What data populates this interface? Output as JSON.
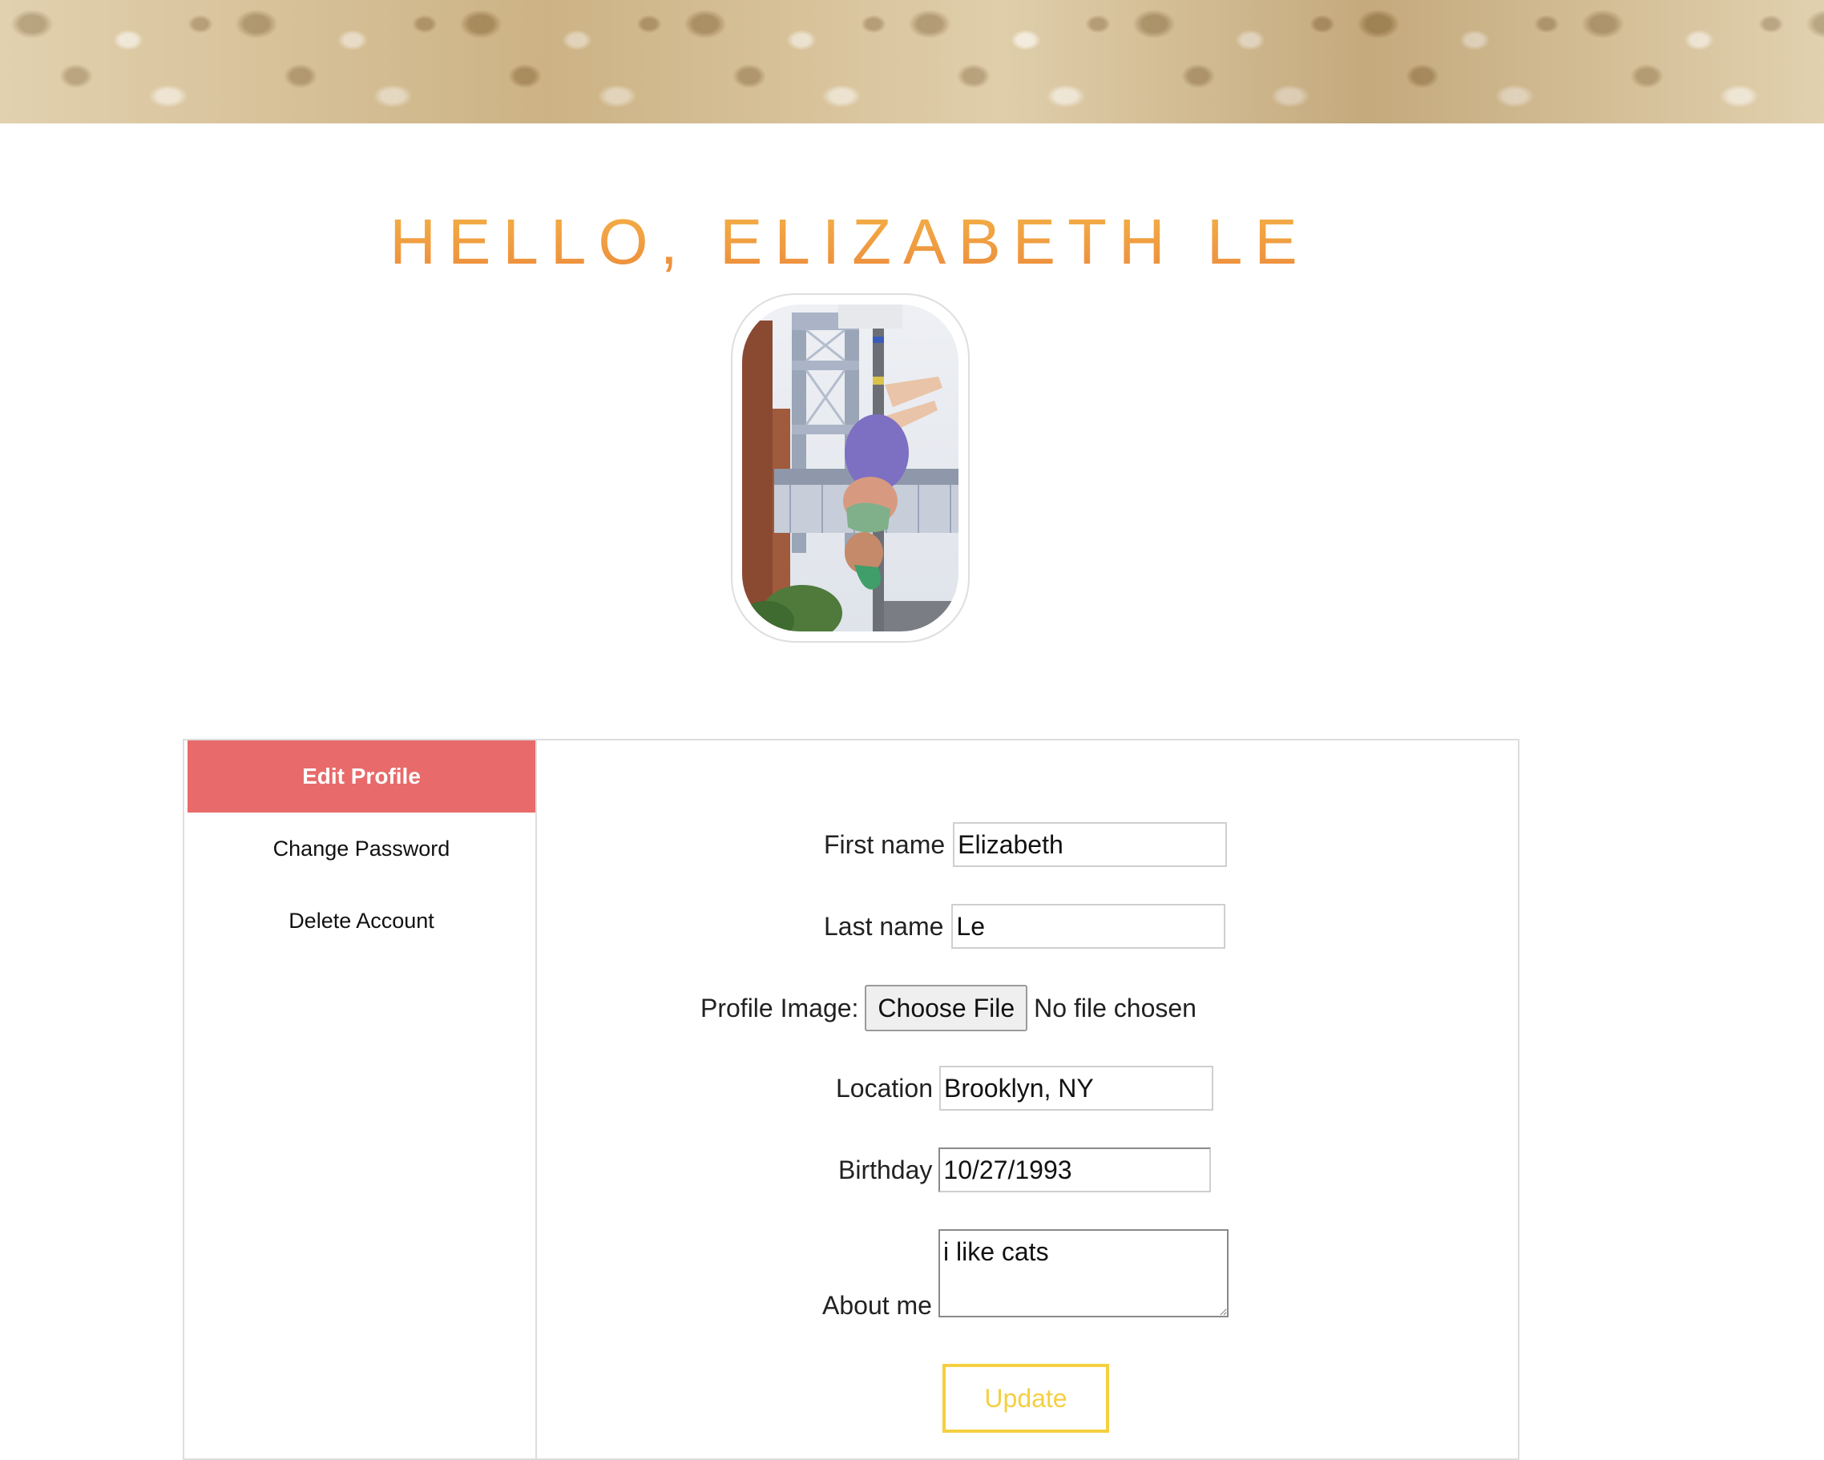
{
  "greeting": "HELLO, ELIZABETH LE",
  "sidebar": {
    "items": [
      {
        "label": "Edit Profile",
        "active": true
      },
      {
        "label": "Change Password",
        "active": false
      },
      {
        "label": "Delete Account",
        "active": false
      }
    ]
  },
  "form": {
    "first_name": {
      "label": "First name",
      "value": "Elizabeth"
    },
    "last_name": {
      "label": "Last name",
      "value": "Le"
    },
    "profile_image": {
      "label": "Profile Image:",
      "button": "Choose File",
      "status": "No file chosen"
    },
    "location": {
      "label": "Location",
      "value": "Brooklyn, NY"
    },
    "birthday": {
      "label": "Birthday",
      "value": "10/27/1993"
    },
    "about": {
      "label": "About me",
      "value": "i like cats"
    },
    "submit_label": "Update"
  },
  "colors": {
    "accent_active": "#e86a6a",
    "greeting": "#f0a03a",
    "update_button": "#f5cf40"
  }
}
